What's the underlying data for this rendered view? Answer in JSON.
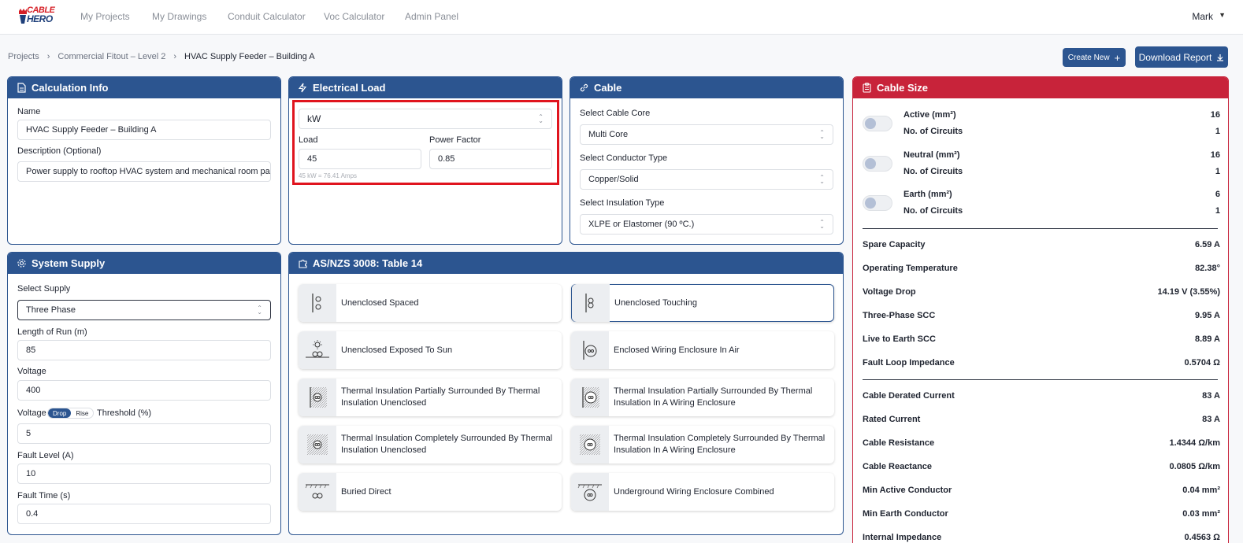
{
  "nav": {
    "logo_line1": "CABLE",
    "logo_line2": "HERO",
    "links": [
      "My Projects",
      "My Drawings",
      "Conduit Calculator",
      "Voc Calculator",
      "Admin Panel"
    ],
    "user": "Mark"
  },
  "breadcrumb": [
    "Projects",
    "Commercial Fitout – Level 2",
    "HVAC Supply Feeder – Building A"
  ],
  "actions": {
    "create_new": "Create New",
    "download_report": "Download Report"
  },
  "calc_info": {
    "title": "Calculation Info",
    "name_label": "Name",
    "name_value": "HVAC Supply Feeder – Building A",
    "desc_label": "Description (Optional)",
    "desc_value": "Power supply to rooftop HVAC system and mechanical room panel;"
  },
  "electrical_load": {
    "title": "Electrical Load",
    "unit": "kW",
    "load_label": "Load",
    "load_value": "45",
    "pf_label": "Power Factor",
    "pf_value": "0.85",
    "hint": "45 kW = 76.41 Amps"
  },
  "cable": {
    "title": "Cable",
    "core_label": "Select Cable Core",
    "core_value": "Multi Core",
    "conductor_label": "Select Conductor Type",
    "conductor_value": "Copper/Solid",
    "insulation_label": "Select Insulation Type",
    "insulation_value": "XLPE or Elastomer (90 ºC.)"
  },
  "system_supply": {
    "title": "System Supply",
    "supply_label": "Select Supply",
    "supply_value": "Three Phase",
    "length_label": "Length of Run (m)",
    "length_value": "85",
    "voltage_label": "Voltage",
    "voltage_value": "400",
    "vd_prefix": "Voltage",
    "vd_drop": "Drop",
    "vd_rise": "Rise",
    "vd_suffix": "Threshold (%)",
    "threshold_value": "5",
    "fault_level_label": "Fault Level (A)",
    "fault_level_value": "10",
    "fault_time_label": "Fault Time (s)",
    "fault_time_value": "0.4"
  },
  "table14": {
    "title": "AS/NZS 3008: Table 14",
    "items": [
      {
        "label": "Unenclosed Spaced",
        "icon": "spaced-icon"
      },
      {
        "label": "Unenclosed Touching",
        "icon": "touching-icon",
        "selected": true
      },
      {
        "label": "Unenclosed Exposed To Sun",
        "icon": "sun-icon"
      },
      {
        "label": "Enclosed Wiring Enclosure In Air",
        "icon": "enclosure-air-icon"
      },
      {
        "label": "Thermal Insulation Partially Surrounded By Thermal Insulation Unenclosed",
        "icon": "thermal-partial-icon"
      },
      {
        "label": "Thermal Insulation Partially Surrounded By Thermal Insulation In A Wiring Enclosure",
        "icon": "thermal-partial-enclosure-icon"
      },
      {
        "label": "Thermal Insulation Completely Surrounded By Thermal Insulation Unenclosed",
        "icon": "thermal-complete-icon"
      },
      {
        "label": "Thermal Insulation Completely Surrounded By Thermal Insulation In A Wiring Enclosure",
        "icon": "thermal-complete-enclosure-icon"
      },
      {
        "label": "Buried Direct",
        "icon": "buried-icon"
      },
      {
        "label": "Underground Wiring Enclosure Combined",
        "icon": "underground-icon"
      }
    ]
  },
  "cable_size": {
    "title": "Cable Size",
    "conductors": [
      {
        "label": "Active (mm²)",
        "value": "16",
        "circuits_label": "No. of Circuits",
        "circuits": "1"
      },
      {
        "label": "Neutral (mm²)",
        "value": "16",
        "circuits_label": "No. of Circuits",
        "circuits": "1"
      },
      {
        "label": "Earth (mm²)",
        "value": "6",
        "circuits_label": "No. of Circuits",
        "circuits": "1"
      }
    ],
    "results1": [
      {
        "label": "Spare Capacity",
        "value": "6.59 A"
      },
      {
        "label": "Operating Temperature",
        "value": "82.38°"
      },
      {
        "label": "Voltage Drop",
        "value": "14.19 V (3.55%)"
      },
      {
        "label": "Three-Phase SCC",
        "value": "9.95 A"
      },
      {
        "label": "Live to Earth SCC",
        "value": "8.89 A"
      },
      {
        "label": "Fault Loop Impedance",
        "value": "0.5704 Ω"
      }
    ],
    "results2": [
      {
        "label": "Cable Derated Current",
        "value": "83 A"
      },
      {
        "label": "Rated Current",
        "value": "83 A"
      },
      {
        "label": "Cable Resistance",
        "value": "1.4344 Ω/km"
      },
      {
        "label": "Cable Reactance",
        "value": "0.0805 Ω/km"
      },
      {
        "label": "Min Active Conductor",
        "value": "0.04 mm²"
      },
      {
        "label": "Min Earth Conductor",
        "value": "0.03 mm²"
      },
      {
        "label": "Internal Impedance",
        "value": "0.4563 Ω"
      }
    ]
  }
}
